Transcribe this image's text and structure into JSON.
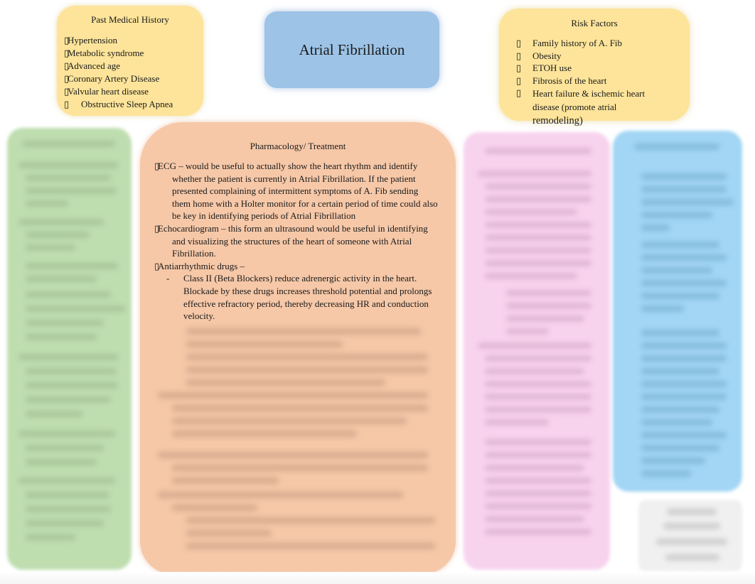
{
  "title": "Atrial Fibrillation",
  "past_medical_history": {
    "heading": "Past Medical History",
    "bullet_glyph": "▯",
    "items": [
      "Hypertension",
      "Metabolic syndrome",
      "Advanced age",
      "Coronary Artery Disease",
      "Valvular heart disease",
      "Obstructive Sleep Apnea"
    ]
  },
  "risk_factors": {
    "heading": "Risk Factors",
    "bullet_glyph": "▯",
    "items": [
      "Family history of A. Fib",
      "Obesity",
      "ETOH use",
      "Fibrosis of the heart"
    ],
    "last_item_main": "Heart failure & ischemic heart disease (promote atrial",
    "last_item_tail": "remodeling)"
  },
  "pharmacology": {
    "heading": "Pharmacology/ Treatment",
    "bullet_glyph": "▯",
    "paragraphs": [
      "ECG – would be useful to actually show the heart rhythm and identify whether the patient is currently in Atrial Fibrillation. If the patient presented complaining of intermittent symptoms of A. Fib sending them home with a Holter monitor for a certain period of time could also be key in identifying periods of Atrial Fibrillation",
      "Echocardiogram – this form an ultrasound would be useful in identifying and visualizing the structures of the heart of someone with Atrial Fibrillation.",
      "Antiarrhythmic drugs –"
    ],
    "sub_items": [
      {
        "dash": "-",
        "text": "Class II (Beta Blockers) reduce adrenergic activity in the heart. Blockade by these drugs increases threshold potential and prolongs effective refractory period, thereby decreasing HR and conduction velocity."
      }
    ]
  },
  "colors": {
    "yellow": "#fde49a",
    "title_blue": "#9dc3e6",
    "green": "#bfdeb0",
    "orange": "#f6c8a8",
    "pink": "#f8d3ee",
    "light_blue": "#a2d6f4",
    "gray": "#f0f0f0"
  }
}
